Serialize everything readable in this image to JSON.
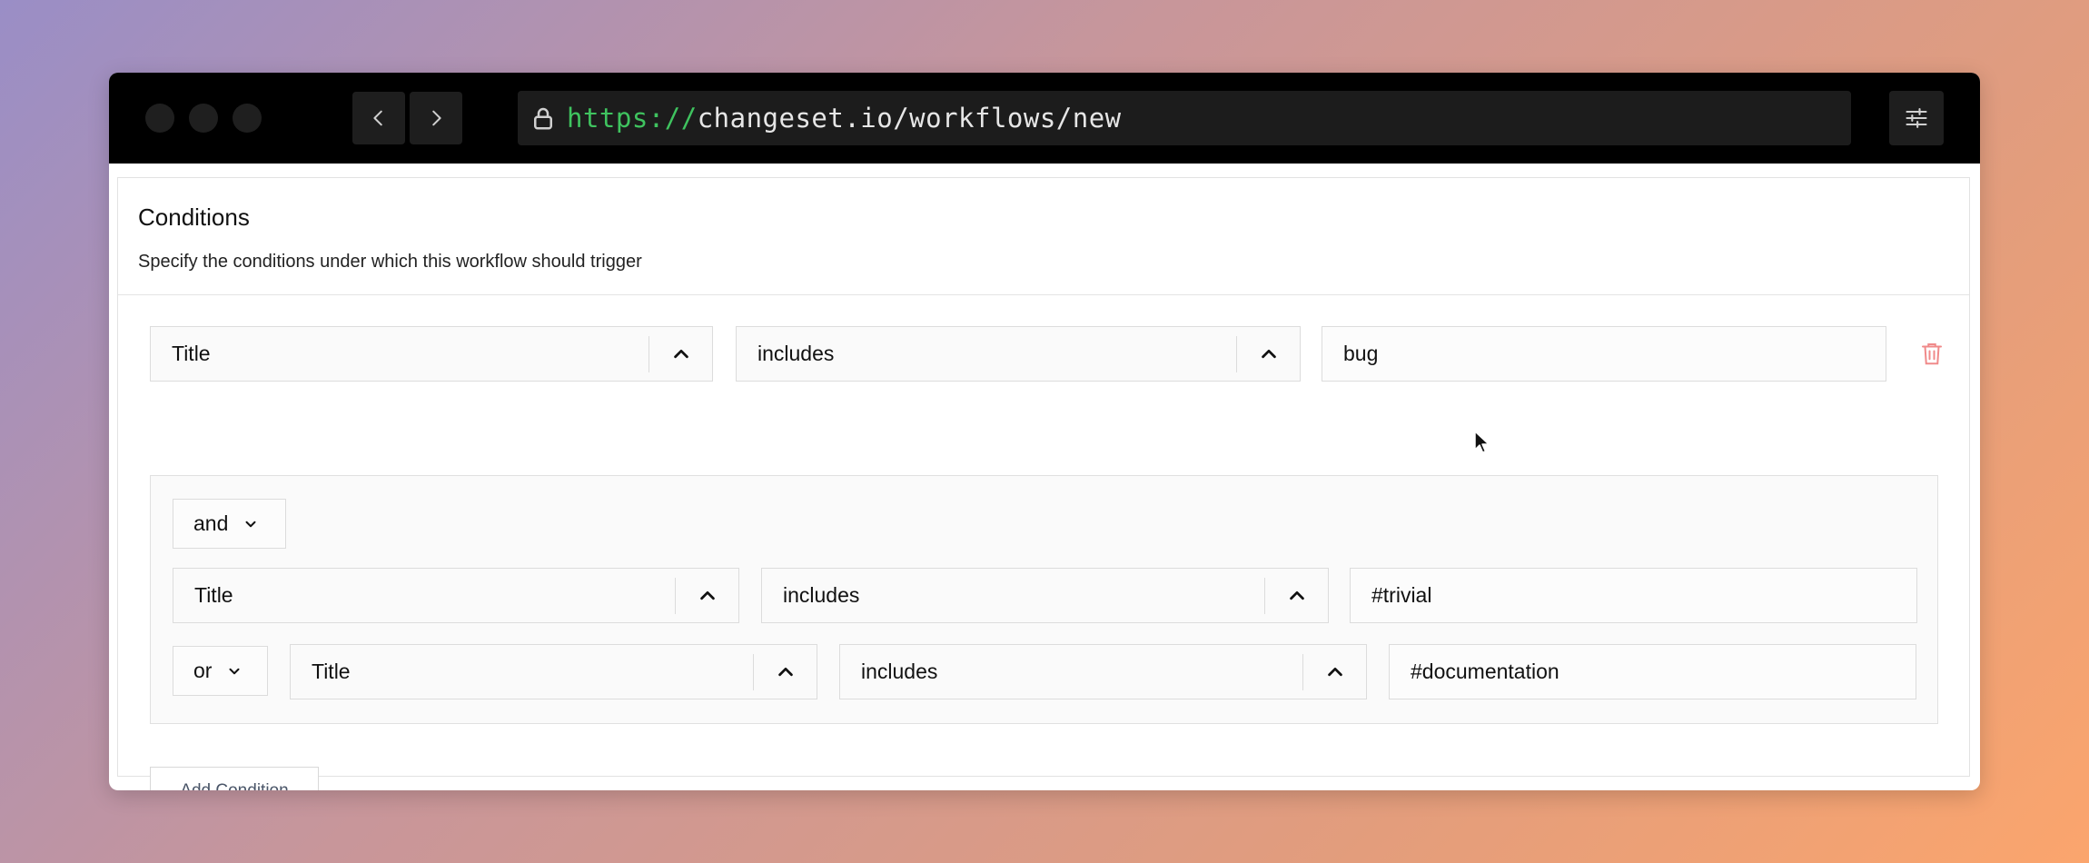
{
  "browser": {
    "url_scheme": "https://",
    "url_rest": "changeset.io/workflows/new"
  },
  "section": {
    "title": "Conditions",
    "description": "Specify the conditions under which this workflow should trigger"
  },
  "condition": {
    "field": "Title",
    "operator": "includes",
    "value": "bug"
  },
  "group": {
    "combinator": "and",
    "rows": [
      {
        "field": "Title",
        "operator": "includes",
        "value": "#trivial"
      },
      {
        "joiner": "or",
        "field": "Title",
        "operator": "includes",
        "value": "#documentation"
      }
    ]
  },
  "actions": {
    "add_condition": "Add Condition"
  },
  "colors": {
    "url_scheme": "#3fc35f",
    "trash": "#f08a8a"
  },
  "icons": [
    "chevron-left-icon",
    "chevron-right-icon",
    "lock-icon",
    "sliders-icon",
    "chevron-up-icon",
    "chevron-down-icon",
    "trash-icon",
    "mouse-cursor-icon"
  ]
}
